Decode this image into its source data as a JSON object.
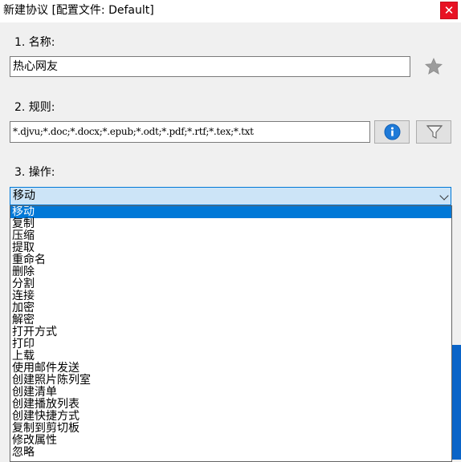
{
  "window": {
    "title": "新建协议 [配置文件: Default]",
    "close_glyph": "✕"
  },
  "name": {
    "label": "1.  名称:",
    "value": "热心网友"
  },
  "rule": {
    "label": "2.  规则:",
    "value": "*.djvu;*.doc;*.docx;*.epub;*.odt;*.pdf;*.rtf;*.tex;*.txt"
  },
  "action": {
    "label": "3.  操作:",
    "selected": "移动",
    "options": [
      "移动",
      "复制",
      "压缩",
      "提取",
      "重命名",
      "删除",
      "分割",
      "连接",
      "加密",
      "解密",
      "打开方式",
      "打印",
      "上载",
      "使用邮件发送",
      "创建照片陈列室",
      "创建清单",
      "创建播放列表",
      "创建快捷方式",
      "复制到剪切板",
      "修改属性",
      "忽略"
    ]
  },
  "icons": {
    "favorite": "star-icon",
    "info": "info-icon",
    "filter": "filter-icon"
  },
  "colors": {
    "accent": "#0078d7",
    "info_blue": "#1976d2",
    "close_red": "#e81123"
  }
}
